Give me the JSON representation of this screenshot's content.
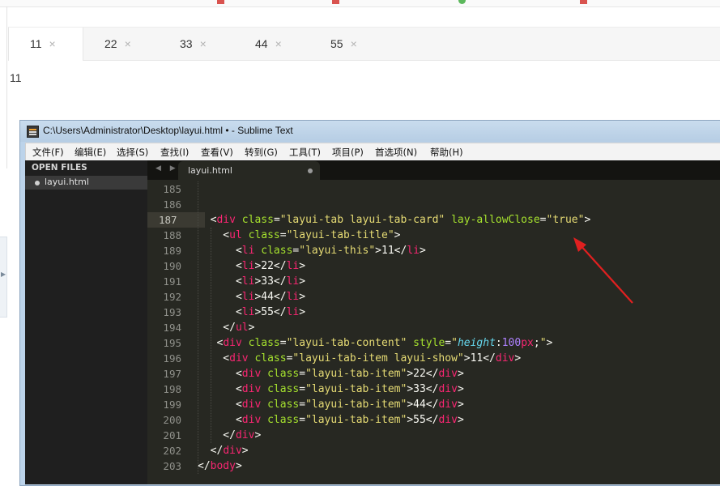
{
  "page": {
    "tabs": [
      {
        "label": "11",
        "close": "×"
      },
      {
        "label": "22",
        "close": "×"
      },
      {
        "label": "33",
        "close": "×"
      },
      {
        "label": "44",
        "close": "×"
      },
      {
        "label": "55",
        "close": "×"
      }
    ],
    "active_tab": "11",
    "content": "11",
    "sidebar_toggle_glyph": "▶"
  },
  "window": {
    "title": "C:\\Users\\Administrator\\Desktop\\layui.html • - Sublime Text",
    "menu": [
      "文件(F)",
      "编辑(E)",
      "选择(S)",
      "查找(I)",
      "查看(V)",
      "转到(G)",
      "工具(T)",
      "项目(P)",
      "首选项(N)",
      "帮助(H)"
    ],
    "sidebar_header": "OPEN FILES",
    "open_file": "layui.html",
    "editor_tab": "layui.html",
    "tab_nav": "◀ ▶"
  },
  "colors": {
    "tag": "#f92672",
    "attr": "#a6e22e",
    "string": "#e6db74",
    "text": "#f8f8f2",
    "css_prop": "#66d9ef",
    "number": "#ae81ff",
    "arrow": "#e02020"
  },
  "code": {
    "line_numbers": [
      "185",
      "186",
      "187",
      "188",
      "189",
      "190",
      "191",
      "192",
      "193",
      "194",
      "195",
      "196",
      "197",
      "198",
      "199",
      "200",
      "201",
      "202",
      "203"
    ],
    "current_line": "187",
    "lines": [
      [],
      [],
      [
        [
          "t",
          "  <"
        ],
        [
          "g",
          "div"
        ],
        [
          "t",
          " "
        ],
        [
          "a",
          "class"
        ],
        [
          "t",
          "="
        ],
        [
          "s",
          "\"layui-tab layui-tab-card\""
        ],
        [
          "t",
          " "
        ],
        [
          "a",
          "lay-allowClose"
        ],
        [
          "t",
          "="
        ],
        [
          "s",
          "\"true\""
        ],
        [
          "t",
          ">"
        ]
      ],
      [
        [
          "t",
          "    <"
        ],
        [
          "g",
          "ul"
        ],
        [
          "t",
          " "
        ],
        [
          "a",
          "class"
        ],
        [
          "t",
          "="
        ],
        [
          "s",
          "\"layui-tab-title\""
        ],
        [
          "t",
          ">"
        ]
      ],
      [
        [
          "t",
          "      <"
        ],
        [
          "g",
          "li"
        ],
        [
          "t",
          " "
        ],
        [
          "a",
          "class"
        ],
        [
          "t",
          "="
        ],
        [
          "s",
          "\"layui-this\""
        ],
        [
          "t",
          ">11</"
        ],
        [
          "g",
          "li"
        ],
        [
          "t",
          ">"
        ]
      ],
      [
        [
          "t",
          "      <"
        ],
        [
          "g",
          "li"
        ],
        [
          "t",
          ">22</"
        ],
        [
          "g",
          "li"
        ],
        [
          "t",
          ">"
        ]
      ],
      [
        [
          "t",
          "      <"
        ],
        [
          "g",
          "li"
        ],
        [
          "t",
          ">33</"
        ],
        [
          "g",
          "li"
        ],
        [
          "t",
          ">"
        ]
      ],
      [
        [
          "t",
          "      <"
        ],
        [
          "g",
          "li"
        ],
        [
          "t",
          ">44</"
        ],
        [
          "g",
          "li"
        ],
        [
          "t",
          ">"
        ]
      ],
      [
        [
          "t",
          "      <"
        ],
        [
          "g",
          "li"
        ],
        [
          "t",
          ">55</"
        ],
        [
          "g",
          "li"
        ],
        [
          "t",
          ">"
        ]
      ],
      [
        [
          "t",
          "    </"
        ],
        [
          "g",
          "ul"
        ],
        [
          "t",
          ">"
        ]
      ],
      [
        [
          "t",
          "   <"
        ],
        [
          "g",
          "div"
        ],
        [
          "t",
          " "
        ],
        [
          "a",
          "class"
        ],
        [
          "t",
          "="
        ],
        [
          "s",
          "\"layui-tab-content\""
        ],
        [
          "t",
          " "
        ],
        [
          "a",
          "style"
        ],
        [
          "t",
          "="
        ],
        [
          "s",
          "\""
        ],
        [
          "p",
          "height"
        ],
        [
          "t",
          ":"
        ],
        [
          "n",
          "100"
        ],
        [
          "g",
          "px"
        ],
        [
          "t",
          ";"
        ],
        [
          "s",
          "\""
        ],
        [
          "t",
          ">"
        ]
      ],
      [
        [
          "t",
          "    <"
        ],
        [
          "g",
          "div"
        ],
        [
          "t",
          " "
        ],
        [
          "a",
          "class"
        ],
        [
          "t",
          "="
        ],
        [
          "s",
          "\"layui-tab-item layui-show\""
        ],
        [
          "t",
          ">11</"
        ],
        [
          "g",
          "div"
        ],
        [
          "t",
          ">"
        ]
      ],
      [
        [
          "t",
          "      <"
        ],
        [
          "g",
          "div"
        ],
        [
          "t",
          " "
        ],
        [
          "a",
          "class"
        ],
        [
          "t",
          "="
        ],
        [
          "s",
          "\"layui-tab-item\""
        ],
        [
          "t",
          ">22</"
        ],
        [
          "g",
          "div"
        ],
        [
          "t",
          ">"
        ]
      ],
      [
        [
          "t",
          "      <"
        ],
        [
          "g",
          "div"
        ],
        [
          "t",
          " "
        ],
        [
          "a",
          "class"
        ],
        [
          "t",
          "="
        ],
        [
          "s",
          "\"layui-tab-item\""
        ],
        [
          "t",
          ">33</"
        ],
        [
          "g",
          "div"
        ],
        [
          "t",
          ">"
        ]
      ],
      [
        [
          "t",
          "      <"
        ],
        [
          "g",
          "div"
        ],
        [
          "t",
          " "
        ],
        [
          "a",
          "class"
        ],
        [
          "t",
          "="
        ],
        [
          "s",
          "\"layui-tab-item\""
        ],
        [
          "t",
          ">44</"
        ],
        [
          "g",
          "div"
        ],
        [
          "t",
          ">"
        ]
      ],
      [
        [
          "t",
          "      <"
        ],
        [
          "g",
          "div"
        ],
        [
          "t",
          " "
        ],
        [
          "a",
          "class"
        ],
        [
          "t",
          "="
        ],
        [
          "s",
          "\"layui-tab-item\""
        ],
        [
          "t",
          ">55</"
        ],
        [
          "g",
          "div"
        ],
        [
          "t",
          ">"
        ]
      ],
      [
        [
          "t",
          "    </"
        ],
        [
          "g",
          "div"
        ],
        [
          "t",
          ">"
        ]
      ],
      [
        [
          "t",
          "  </"
        ],
        [
          "g",
          "div"
        ],
        [
          "t",
          ">"
        ]
      ],
      [
        [
          "t",
          "</"
        ],
        [
          "g",
          "body"
        ],
        [
          "t",
          ">"
        ]
      ]
    ]
  },
  "annotation": {
    "type": "arrow",
    "icon": "red-arrow-icon"
  }
}
